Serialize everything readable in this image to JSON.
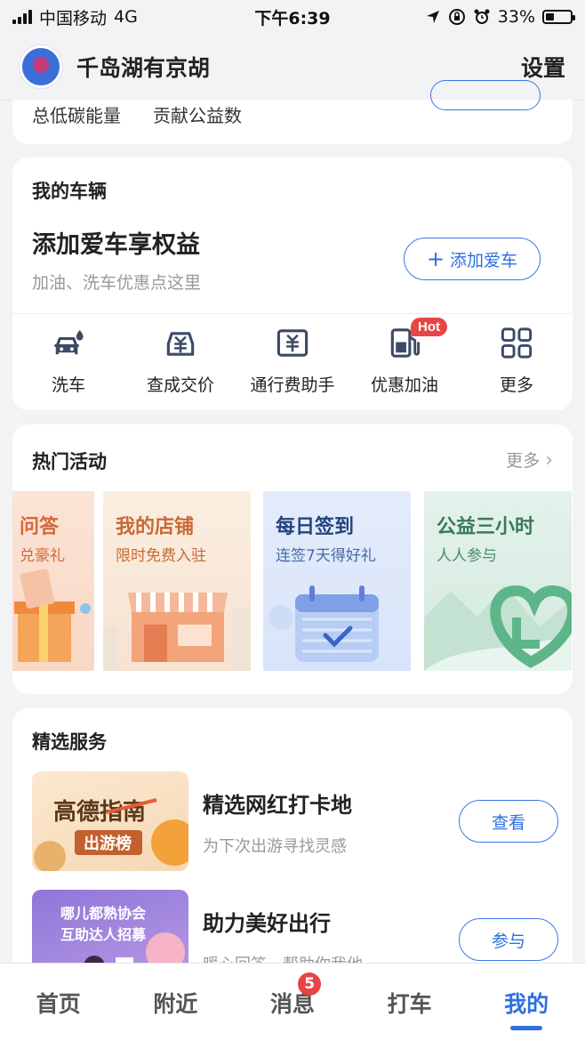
{
  "status_bar": {
    "carrier": "中国移动",
    "network": "4G",
    "time": "下午6:39",
    "battery": "33%",
    "battery_level": 0.33
  },
  "header": {
    "username": "千岛湖有京胡",
    "settings_label": "设置"
  },
  "stats": {
    "low_carbon_label": "总低碳能量",
    "charity_label": "贡献公益数"
  },
  "vehicle": {
    "section_title": "我的车辆",
    "headline": "添加爱车享权益",
    "subtitle": "加油、洗车优惠点这里",
    "add_button": "添加爱车",
    "quick_actions": [
      {
        "label": "洗车",
        "icon": "car-wash-icon"
      },
      {
        "label": "查成交价",
        "icon": "car-price-icon"
      },
      {
        "label": "通行费助手",
        "icon": "toll-icon"
      },
      {
        "label": "优惠加油",
        "icon": "fuel-icon",
        "badge": "Hot"
      },
      {
        "label": "更多",
        "icon": "grid-icon"
      }
    ]
  },
  "activities": {
    "section_title": "热门活动",
    "more_label": "更多",
    "banners": [
      {
        "title": "问答",
        "subtitle": "兑豪礼"
      },
      {
        "title": "我的店铺",
        "subtitle": "限时免费入驻"
      },
      {
        "title": "每日签到",
        "subtitle": "连签7天得好礼"
      },
      {
        "title": "公益三小时",
        "subtitle": "人人参与"
      }
    ]
  },
  "services": {
    "section_title": "精选服务",
    "items": [
      {
        "title": "精选网红打卡地",
        "subtitle": "为下次出游寻找灵感",
        "button": "查看",
        "image_text_1": "高德指南",
        "image_text_2": "出游榜"
      },
      {
        "title": "助力美好出行",
        "subtitle": "暖心回答，帮助你我他",
        "button": "参与",
        "image_text_1": "哪儿都熟协会",
        "image_text_2": "互助达人招募"
      }
    ]
  },
  "bottom_nav": {
    "tabs": [
      {
        "label": "首页"
      },
      {
        "label": "附近"
      },
      {
        "label": "消息",
        "badge": "5"
      },
      {
        "label": "打车"
      },
      {
        "label": "我的"
      }
    ]
  },
  "colors": {
    "accent": "#2f6fe0",
    "badge": "#e84545",
    "background": "#f2f3f5"
  }
}
